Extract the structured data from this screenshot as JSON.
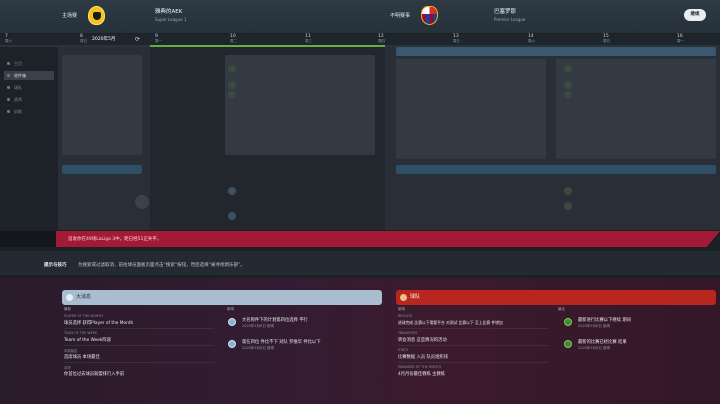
{
  "header": {
    "home_side": "主场赛",
    "home_club": "雅典的AEK",
    "home_league": "Super League 1",
    "away_side": "不明赛事",
    "away_club": "巴塞罗那",
    "away_league": "Premier League",
    "continue_label": "继续"
  },
  "timeline": {
    "current": "2020年5月",
    "days": [
      {
        "d": "7",
        "w": "周六"
      },
      {
        "d": "8",
        "w": "周日"
      },
      {
        "d": "9",
        "w": "周一"
      },
      {
        "d": "10",
        "w": "周二"
      },
      {
        "d": "11",
        "w": "周三"
      },
      {
        "d": "12",
        "w": "周四"
      },
      {
        "d": "13",
        "w": "周五"
      },
      {
        "d": "14",
        "w": "周六"
      },
      {
        "d": "15",
        "w": "周日"
      },
      {
        "d": "16",
        "w": "周一"
      }
    ]
  },
  "nav": {
    "items": [
      "主页",
      "收件箱",
      "球队",
      "战术",
      "训练"
    ]
  },
  "alert": {
    "text": "首发你在49场LaLiga 3中，距已经51正失平。"
  },
  "tip": {
    "title": "提示与技巧",
    "text": "为搜索或过滤取消，前往球员面板页面点击“搜索”按钮，然后选择“被寻找俱乐部”。"
  },
  "left_panel": {
    "title": "大消息",
    "col_left": "最新",
    "col_right": "新闻",
    "rows": [
      {
        "label": "PLAYER OF THE MONTH",
        "value": "球员选择 获得Player of the Month"
      },
      {
        "label": "TEAM OF THE WEEK",
        "value": "Team of the Week阵容"
      },
      {
        "label": "本周最佳",
        "value": "首席球员 本场最佳"
      },
      {
        "label": "本场",
        "value": "你首位过去球员联盟排行入手前"
      }
    ],
    "news": [
      {
        "title": "大名称件下的计划第四位选择 平行",
        "sub": "2020年5月8日 新闻"
      },
      {
        "title": "现在四位 件比不下 对队 罗维华 件比以下",
        "sub": "2020年5月8日 新闻"
      }
    ]
  },
  "right_panel": {
    "title": "球队",
    "col_left": "新闻",
    "col_right": "最近",
    "rows": [
      {
        "label": "RESULTS",
        "value": "进球完成 比赛以下需要平台 对测试 比赛以下 至上比赛 件增加"
      },
      {
        "label": "TRANSFERS",
        "value": "转会消息 这些情况的活动"
      },
      {
        "label": "STATS",
        "value": "比赛数据 入员 队员组织排"
      },
      {
        "label": "MANAGER OF THE MONTH",
        "value": "4月月份最佳教练 主教练"
      }
    ],
    "news": [
      {
        "title": "最新进行比赛以下继续 期间",
        "sub": "2020年5月8日 新闻"
      },
      {
        "title": "最新的比赛已经比赛 结果",
        "sub": "2020年5月8日 新闻"
      }
    ]
  },
  "colors": {
    "alert": "#a31a35",
    "left_head": "#9fb4c8",
    "right_head": "#b8271f",
    "progress": "#5fb33a"
  }
}
